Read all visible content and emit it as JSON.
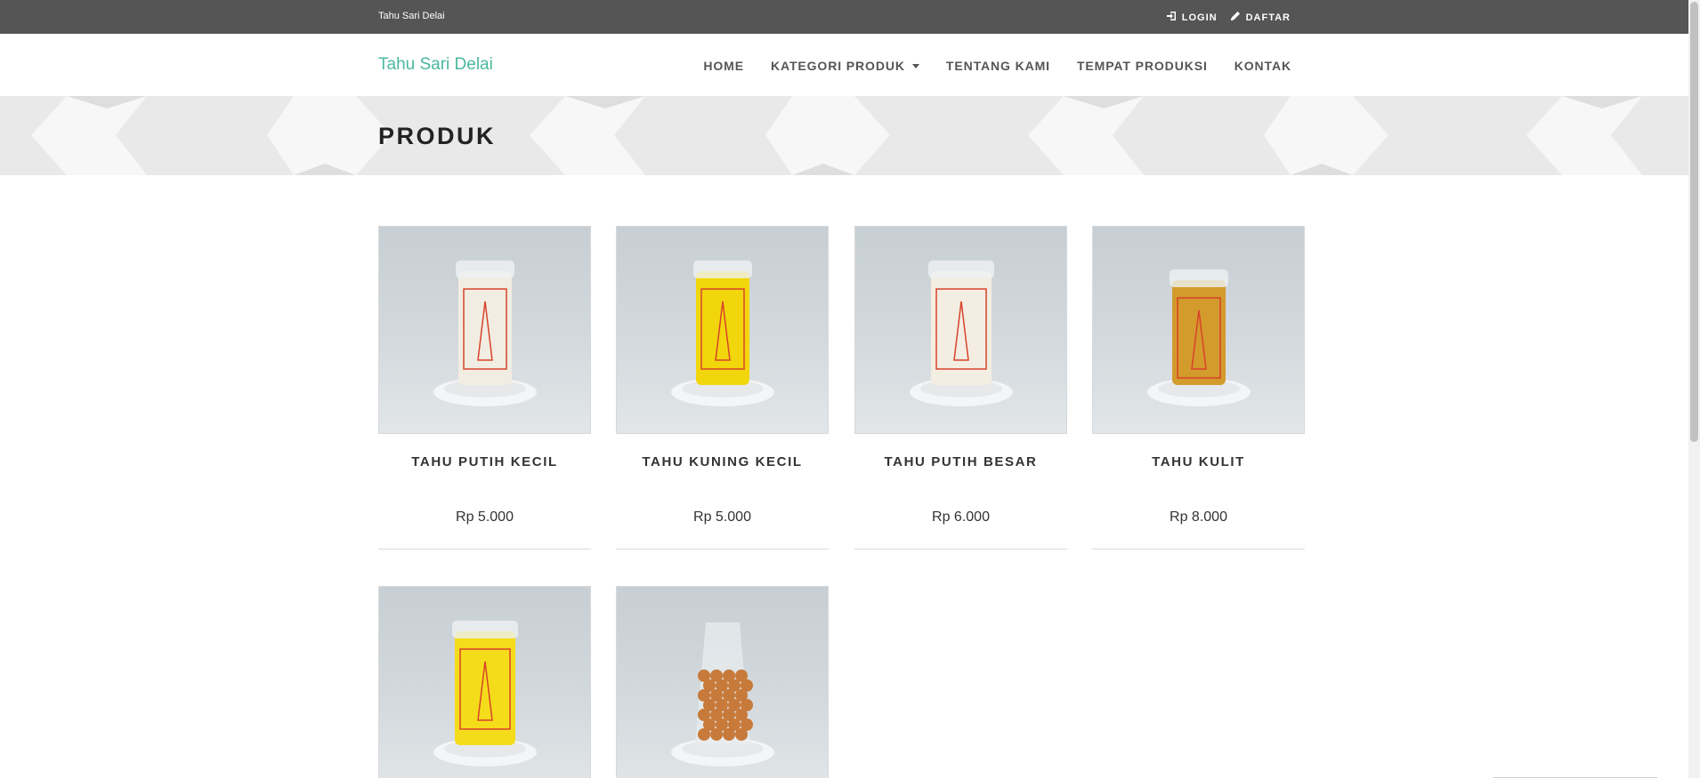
{
  "topbar": {
    "brand": "Tahu Sari Delai",
    "login_label": "LOGIN",
    "login_icon": "sign-in-icon",
    "register_label": "DAFTAR",
    "register_icon": "pencil-icon"
  },
  "navbar": {
    "logo": "Tahu Sari Delai",
    "menu": [
      {
        "label": "HOME"
      },
      {
        "label": "KATEGORI PRODUK"
      },
      {
        "label": "TENTANG KAMI"
      },
      {
        "label": "TEMPAT PRODUKSI"
      },
      {
        "label": "KONTAK"
      }
    ]
  },
  "hero": {
    "title": "PRODUK"
  },
  "products": [
    {
      "name": "TAHU PUTIH KECIL",
      "price": "Rp 5.000",
      "color": "#f2ede2"
    },
    {
      "name": "TAHU KUNING KECIL",
      "price": "Rp 5.000",
      "color": "#f2d60c"
    },
    {
      "name": "TAHU PUTIH BESAR",
      "price": "Rp 6.000",
      "color": "#f3ede2"
    },
    {
      "name": "TAHU KULIT",
      "price": "Rp 8.000",
      "color": "#d39a2c"
    },
    {
      "name": "",
      "price": "",
      "color": "#f5dc1a"
    },
    {
      "name": "",
      "price": "",
      "color": "#c77a3a"
    }
  ],
  "colors": {
    "accent": "#49b99e",
    "topbar": "#555555"
  }
}
